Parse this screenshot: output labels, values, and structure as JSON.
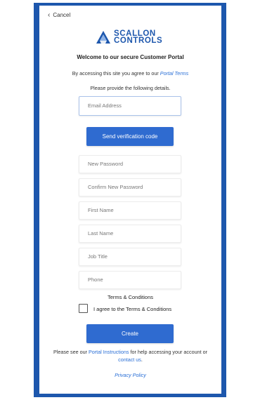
{
  "nav": {
    "cancel_label": "Cancel"
  },
  "brand": {
    "line1": "SCALLON",
    "line2": "CONTROLS",
    "color": "#1d57ad"
  },
  "intro": {
    "welcome": "Welcome to our secure Customer Portal",
    "agree_prefix": "By accessing this site you agree to our ",
    "agree_link": "Portal Terms",
    "provide": "Please provide the following details."
  },
  "form": {
    "email_placeholder": "Email Address",
    "verify_label": "Send verification code",
    "new_password_placeholder": "New Password",
    "confirm_password_placeholder": "Confirm New Password",
    "first_name_placeholder": "First Name",
    "last_name_placeholder": "Last Name",
    "job_title_placeholder": "Job Title",
    "phone_placeholder": "Phone",
    "terms_heading": "Terms & Conditions",
    "terms_checkbox_label": "I agree to the Terms & Conditions",
    "create_label": "Create"
  },
  "footer": {
    "help_prefix": "Please see our ",
    "instructions_link": "Portal Instructions",
    "help_middle": " for help accessing your account or ",
    "contact_link": "contact us",
    "help_suffix": ".",
    "privacy_link": "Privacy Policy"
  },
  "colors": {
    "accent": "#2f6bd0",
    "frame": "#1d57ad",
    "link": "#2a6fd6"
  }
}
